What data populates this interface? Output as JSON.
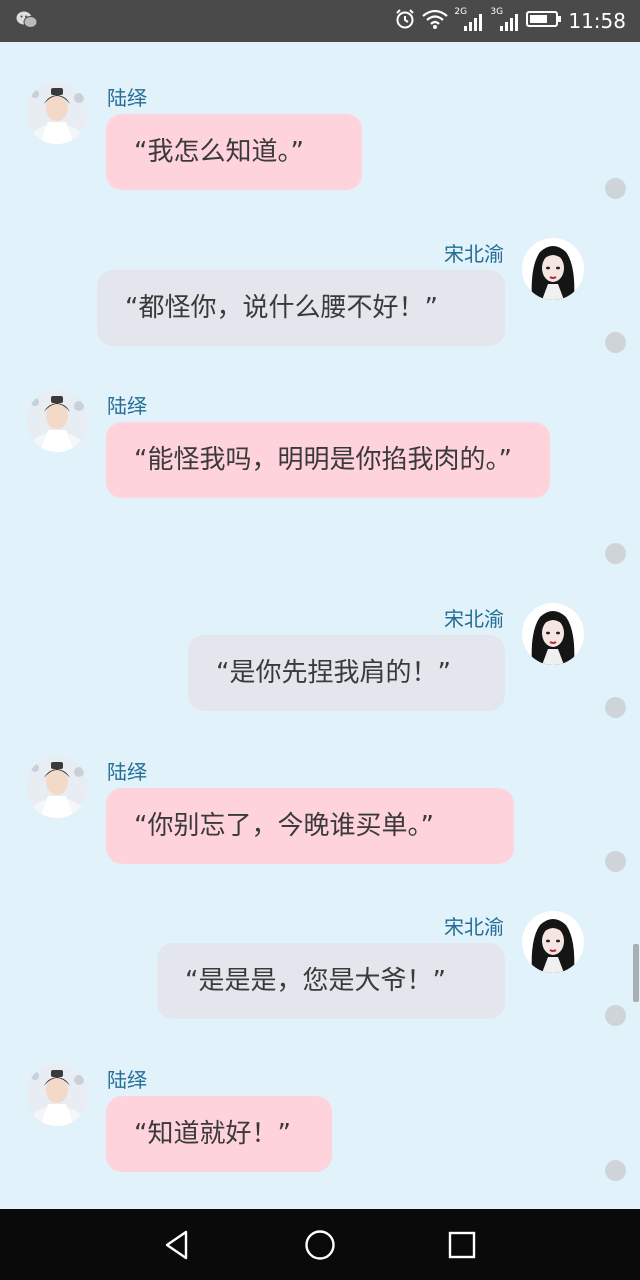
{
  "status_bar": {
    "time": "11:58",
    "net1": "2G",
    "net2": "3G",
    "icons": [
      "wechat-icon",
      "alarm-icon",
      "wifi-icon",
      "signal-icon",
      "battery-icon"
    ]
  },
  "contacts": {
    "left_name": "陆绎",
    "right_name": "宋北渝"
  },
  "messages": [
    {
      "side": "left",
      "name": "陆绎",
      "text": "“我怎么知道。”"
    },
    {
      "side": "right",
      "name": "宋北渝",
      "text": "“都怪你，说什么腰不好！”"
    },
    {
      "side": "left",
      "name": "陆绎",
      "text": "“能怪我吗，明明是你掐我肉的。”"
    },
    {
      "side": "right",
      "name": "宋北渝",
      "text": "“是你先捏我肩的！”"
    },
    {
      "side": "left",
      "name": "陆绎",
      "text": "“你别忘了，今晚谁买单。”"
    },
    {
      "side": "right",
      "name": "宋北渝",
      "text": "“是是是，您是大爷！”"
    },
    {
      "side": "left",
      "name": "陆绎",
      "text": "“知道就好！”"
    }
  ],
  "colors": {
    "background": "#e2f2fb",
    "left_bubble": "#ffd3dc",
    "right_bubble": "#e3e6ec",
    "name_text": "#236e95"
  }
}
